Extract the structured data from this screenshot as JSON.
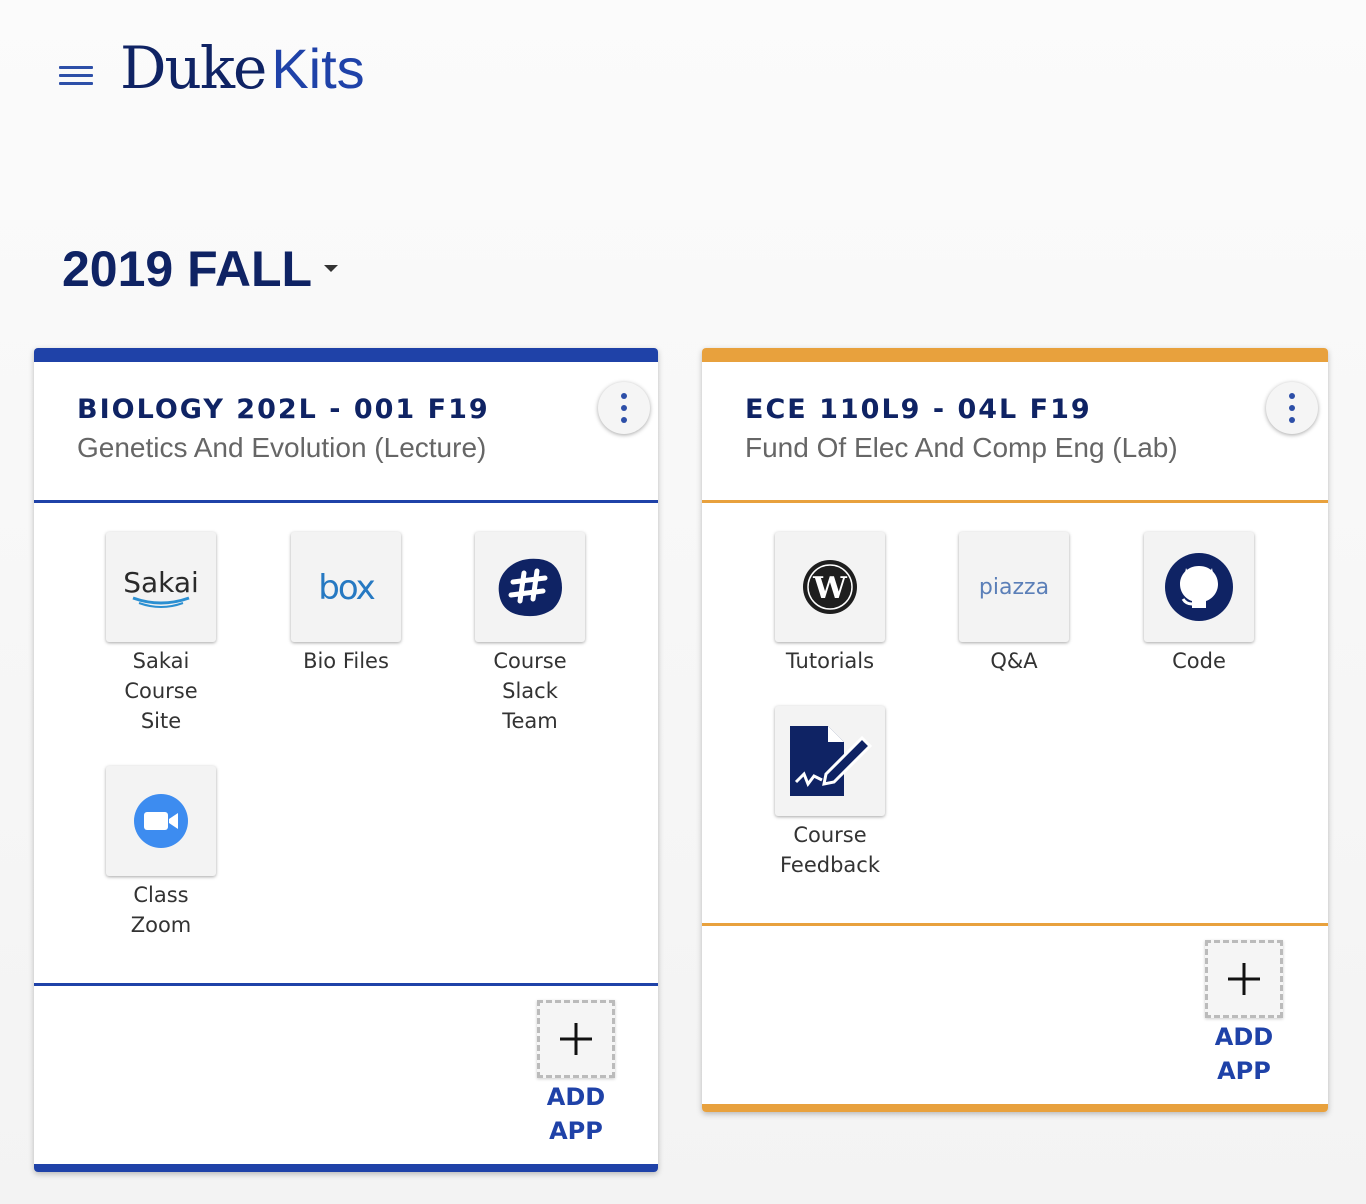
{
  "header": {
    "logo_duke": "Duke",
    "logo_kits": "Kits"
  },
  "term": {
    "label": "2019 FALL"
  },
  "colors": {
    "blue": "#1f42a8",
    "orange": "#e8a13d",
    "navy": "#0f2364"
  },
  "cards": [
    {
      "code": "BIOLOGY 202L - 001 F19",
      "title": "Genetics And Evolution (Lecture)",
      "apps": [
        {
          "label": "Sakai Course Site",
          "icon": "sakai-icon",
          "logo_text": "Sakai"
        },
        {
          "label": "Bio Files",
          "icon": "box-icon",
          "logo_text": "box"
        },
        {
          "label": "Course Slack Team",
          "icon": "slack-icon"
        },
        {
          "label": "Class Zoom",
          "icon": "zoom-icon"
        }
      ],
      "add_app": "ADD APP"
    },
    {
      "code": "ECE 110L9 - 04L F19",
      "title": "Fund Of Elec And Comp Eng (Lab)",
      "apps": [
        {
          "label": "Tutorials",
          "icon": "wordpress-icon",
          "logo_text": "W"
        },
        {
          "label": "Q&A",
          "icon": "piazza-icon",
          "logo_text": "piazza"
        },
        {
          "label": "Code",
          "icon": "github-icon"
        },
        {
          "label": "Course Feedback",
          "icon": "feedback-form-icon"
        }
      ],
      "add_app": "ADD APP"
    }
  ]
}
